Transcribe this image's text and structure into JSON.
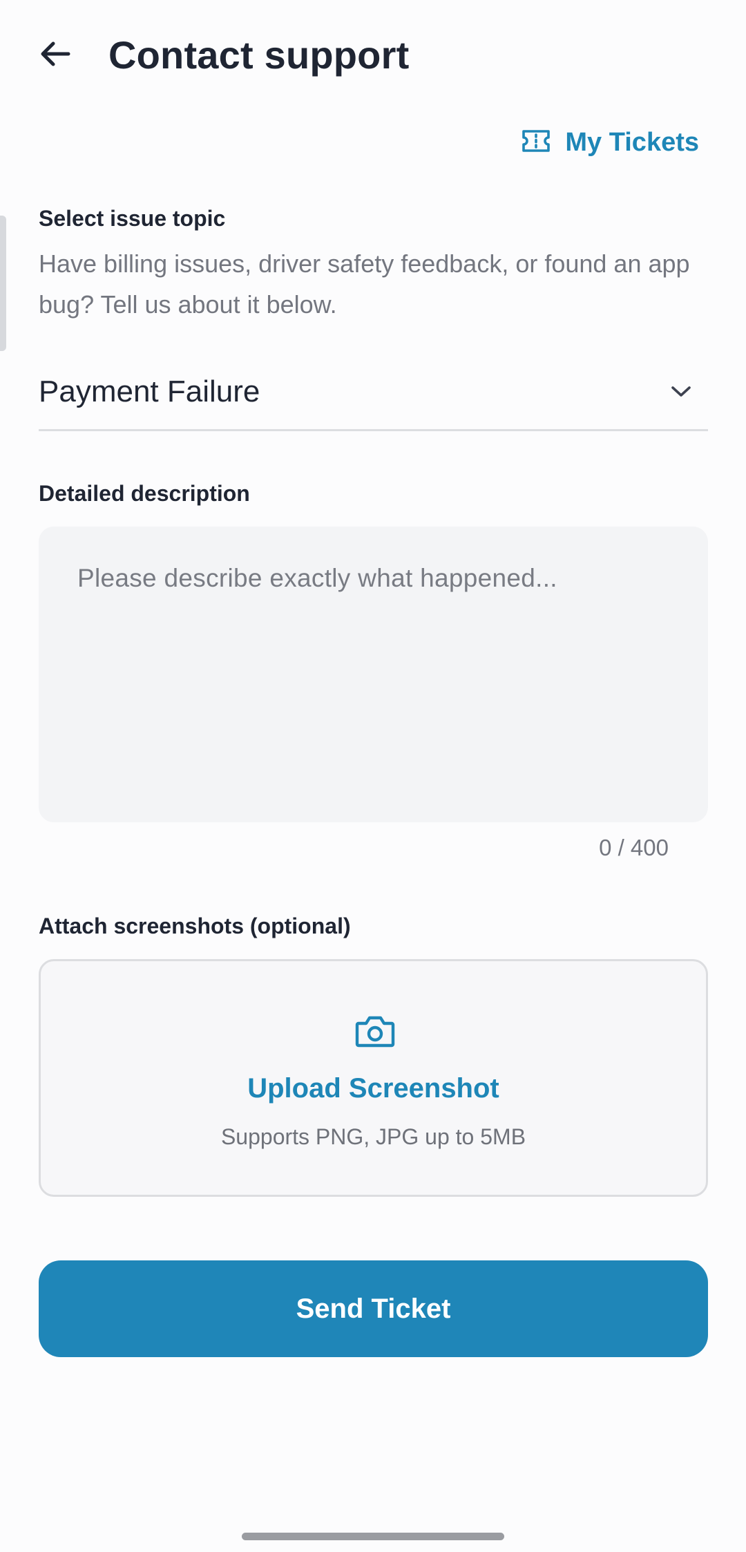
{
  "header": {
    "title": "Contact support",
    "back_icon": "arrow-left-icon"
  },
  "my_tickets": {
    "label": "My Tickets",
    "icon": "ticket-icon"
  },
  "topic": {
    "label": "Select issue topic",
    "helper": "Have billing issues, driver safety feedback, or found an app bug? Tell us about it below.",
    "selected": "Payment Failure",
    "chevron_icon": "chevron-down-icon"
  },
  "description": {
    "label": "Detailed description",
    "placeholder": "Please describe exactly what happened...",
    "value": "",
    "counter": "0 / 400"
  },
  "attach": {
    "label": "Attach screenshots (optional)",
    "upload_title": "Upload Screenshot",
    "upload_sub": "Supports PNG, JPG up to 5MB",
    "icon": "camera-icon"
  },
  "submit": {
    "label": "Send Ticket"
  },
  "colors": {
    "accent": "#1f86b8",
    "text_primary": "#1f2533",
    "text_secondary": "#73767f",
    "background": "#fcfcfd",
    "field_bg": "#f3f4f6",
    "border": "#dcdde0"
  }
}
